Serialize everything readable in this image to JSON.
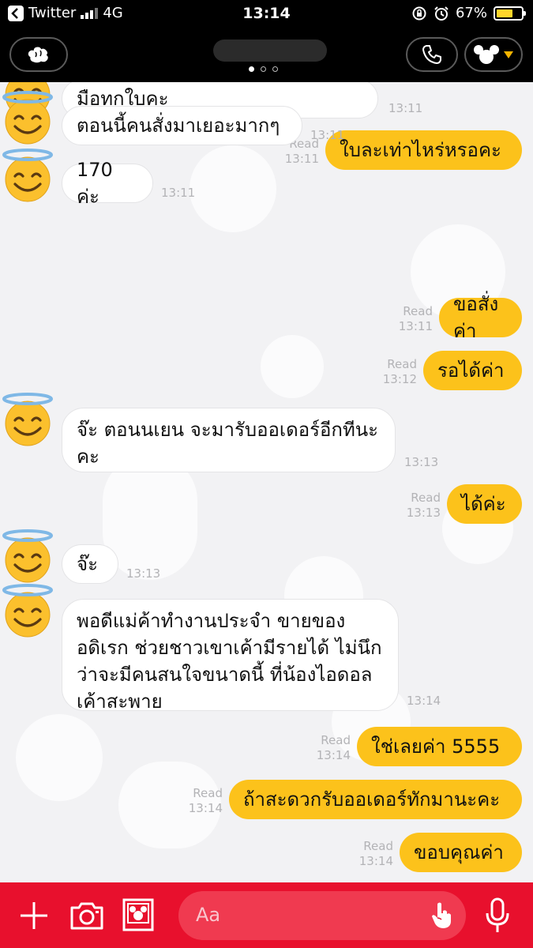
{
  "status_bar": {
    "back_app": "Twitter",
    "network": "4G",
    "time": "13:14",
    "battery": "67%",
    "battery_level": 0.67
  },
  "header": {
    "back_icon": "fist-hand-icon",
    "call_icon": "phone-icon",
    "menu_icon": "mickey-icon",
    "page_indicator": {
      "count": 3,
      "active": 0
    }
  },
  "messages": [
    {
      "side": "in",
      "text": "มือทุกใบคะ",
      "time": "13:11"
    },
    {
      "side": "out",
      "text": "ใบละเท่าไหร่หรอคะ",
      "read": "Read",
      "time": "13:11"
    },
    {
      "side": "in",
      "text": "ตอนนี้คนสั่งมาเยอะมากๆ",
      "time": "13:11"
    },
    {
      "side": "in",
      "text": "170 ค่ะ",
      "time": "13:11"
    },
    {
      "side": "out",
      "text": "ขอสั่งค่า",
      "read": "Read",
      "time": "13:11"
    },
    {
      "side": "out",
      "text": "รอได้ค่า",
      "read": "Read",
      "time": "13:12"
    },
    {
      "side": "in",
      "text": "จ๊ะ ตอนนเยน จะมารับออเดอร์อีกทีนะ\nคะ",
      "time": "13:13"
    },
    {
      "side": "out",
      "text": "ได้ค่ะ",
      "read": "Read",
      "time": "13:13"
    },
    {
      "side": "in",
      "text": "จ๊ะ",
      "time": "13:13"
    },
    {
      "side": "in",
      "text": "พอดีแม่ค้าทำงานประจำ ขายของ\nอดิเรก ช่วยชาวเขาเค้ามีรายได้ ไม่นึก\nว่าจะมีคนสนใจขนาดนี้ ที่น้องไอดอล\nเค้าสะพาย",
      "time": "13:14"
    },
    {
      "side": "out",
      "text": "ใช่เลยค่า 5555",
      "read": "Read",
      "time": "13:14"
    },
    {
      "side": "out",
      "text": "ถ้าสะดวกรับออเดอร์ทักมานะคะ",
      "read": "Read",
      "time": "13:14"
    },
    {
      "side": "out",
      "text": "ขอบคุณค่า",
      "read": "Read",
      "time": "13:14"
    }
  ],
  "input_bar": {
    "placeholder": "Aa",
    "icons": [
      "plus-icon",
      "camera-icon",
      "sticker-icon",
      "hand-icon",
      "microphone-icon"
    ]
  },
  "colors": {
    "outgoing_bubble": "#fcc21b",
    "incoming_bubble": "#ffffff",
    "input_bar": "#e8102d",
    "header": "#000000"
  }
}
